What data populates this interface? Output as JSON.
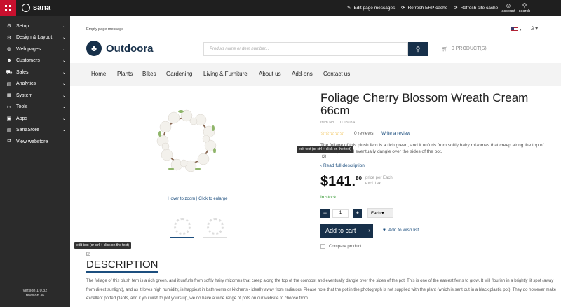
{
  "topbar": {
    "brand": "sana",
    "actions": [
      {
        "label": "Edit page messages",
        "icon": "pencil-icon"
      },
      {
        "label": "Refresh ERP cache",
        "icon": "refresh-icon"
      },
      {
        "label": "Refresh site cache",
        "icon": "refresh-icon"
      }
    ],
    "account_label": "account",
    "search_label": "search"
  },
  "sidebar": {
    "items": [
      {
        "label": "Setup",
        "icon": "gear-icon",
        "has_chevron": true
      },
      {
        "label": "Design & Layout",
        "icon": "gear-icon",
        "has_chevron": true
      },
      {
        "label": "Web pages",
        "icon": "globe-icon",
        "has_chevron": true
      },
      {
        "label": "Customers",
        "icon": "users-icon",
        "has_chevron": true
      },
      {
        "label": "Sales",
        "icon": "cart-icon",
        "has_chevron": true
      },
      {
        "label": "Analytics",
        "icon": "chart-icon",
        "has_chevron": true
      },
      {
        "label": "System",
        "icon": "grid-icon",
        "has_chevron": true
      },
      {
        "label": "Tools",
        "icon": "wrench-icon",
        "has_chevron": true
      },
      {
        "label": "Apps",
        "icon": "apps-icon",
        "has_chevron": true
      },
      {
        "label": "SanaStore",
        "icon": "store-icon",
        "has_chevron": true
      },
      {
        "label": "View webstore",
        "icon": "external-icon",
        "has_chevron": false
      }
    ],
    "version": "version 1.0.32",
    "revision": "revision 36"
  },
  "store": {
    "empty_message": "Empty page message",
    "logo": "Outdoora",
    "search_placeholder": "Product name or Item number...",
    "cart_label": "0 PRODUCT(S)",
    "menu": [
      "Home",
      "Plants",
      "Bikes",
      "Gardening",
      "Living & Furniture",
      "About us",
      "Add-ons",
      "Contact us"
    ]
  },
  "product": {
    "title": "Foliage Cherry Blossom Wreath Cream 66cm",
    "item_no_label": "Item No.",
    "item_no": "TL1503A",
    "stars": "☆☆☆☆☆",
    "reviews": "0 reviews",
    "write_review": "Write a review",
    "short_description": "The foliage of this plush fern is a rich green, and it unfurls from softly hairy rhizomes that creep along the top of the compost and eventually dangle over the sides of the pot.",
    "tooltip": "edit text (or ctrl + click on the text)",
    "read_more": "‹ Read full description",
    "price_main": "$141.",
    "price_cents": "80",
    "price_per": "price per Each",
    "price_tax": "excl. tax",
    "stock": "In stock",
    "qty": "1",
    "uom": "Each",
    "add_to_cart": "Add to cart",
    "wishlist": "Add to wish list",
    "compare": "Compare product",
    "hover_zoom": "+ Hover to zoom | Click to enlarge",
    "desc_heading": "DESCRIPTION",
    "long_description": "The foliage of this plush fern is a rich green, and it unfurls from softly hairy rhizomes that creep along the top of the compost and eventually dangle over the sides of the pot. This is one of the easiest ferns to grow. It will flourish in a brightly lit spot (away from direct sunlight), and as it loves high humidity, is happiest in bathrooms or kitchens - ideally away from radiators. Please note that the pot in the photograph is not supplied with the plant (which is sent out in a black plastic pot). They do however make excellent potted plants, and if you wish to pot yours up, we do have a wide range of pots on our website to choose from."
  }
}
